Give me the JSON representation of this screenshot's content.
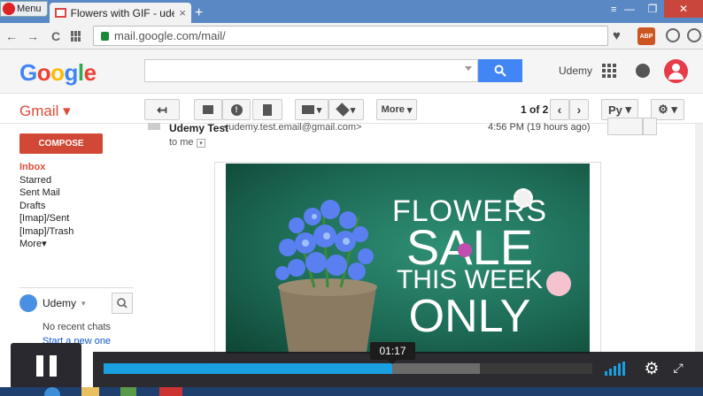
{
  "browser": {
    "menu_label": "Menu",
    "tab_title": "Flowers with GIF - udemy",
    "new_tab": "+",
    "close_tab": "×",
    "url": "mail.google.com/mail/",
    "back": "←",
    "forward": "→",
    "reload": "C"
  },
  "gmail": {
    "logo_letters": [
      "G",
      "o",
      "o",
      "g",
      "l",
      "e"
    ],
    "logo_colors": [
      "#4285f4",
      "#ea4335",
      "#fbbc05",
      "#4285f4",
      "#34a853",
      "#ea4335"
    ],
    "account_name": "Udemy",
    "app_label": "Gmail",
    "toolbar": {
      "more_label": "More",
      "page_count": "1 of 2",
      "input_tool": "Ру"
    },
    "compose_label": "COMPOSE",
    "folders": [
      "Inbox",
      "Starred",
      "Sent Mail",
      "Drafts",
      "[Imap]/Sent",
      "[Imap]/Trash",
      "More"
    ],
    "chat": {
      "user": "Udemy",
      "no_chats": "No recent chats",
      "start_new": "Start a new one"
    },
    "message": {
      "sender": "Udemy Test",
      "email": "<udemy.test.email@gmail.com>",
      "time": "4:56 PM (19 hours ago)",
      "to": "to me"
    },
    "image_text": [
      "FLOWERS",
      "SALE",
      "THIS WEEK",
      "ONLY"
    ]
  },
  "video": {
    "time_tooltip": "01:17",
    "progress": 0.59,
    "buffered": 0.77
  }
}
